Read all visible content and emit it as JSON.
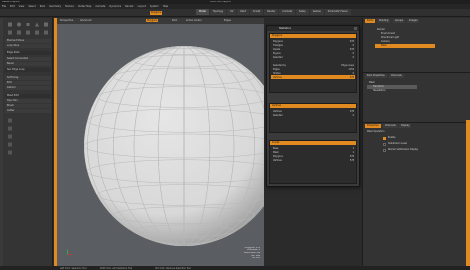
{
  "window": {
    "title": "Default Layout",
    "doc_title": "Modo 801 Layout"
  },
  "menu": [
    "File",
    "Edit",
    "View",
    "Select",
    "Item",
    "Geometry",
    "Texture",
    "Vertex Map",
    "Animate",
    "Dynamics",
    "Render",
    "Layout",
    "System",
    "Help"
  ],
  "topbar": {
    "mode_label": "Polygons",
    "tabs": [
      "Model",
      "Topology",
      "UV",
      "Paint",
      "Sculpt",
      "Render",
      "Animate",
      "Setup",
      "Games",
      "Schematic Fusion"
    ]
  },
  "left_panel": {
    "rows": [
      "Element Move",
      "Loop Slice",
      "Edge Slide",
      "Select Connected",
      "Bevel",
      "Sel. Edge Loop",
      "Soft Drag",
      "Edit",
      "Deform",
      "Mesh Edit",
      "Topo Pen",
      "Brush",
      "Cutter"
    ]
  },
  "viewport": {
    "header": [
      "Perspective",
      "Advanced",
      "Polygons",
      "Item",
      "Action Center",
      "Edges"
    ],
    "info": [
      "Polygons: 576",
      "Channels: 0",
      "Deformers: ON",
      "GL: 640",
      "20 mm"
    ]
  },
  "dialog": {
    "title": "Statistics",
    "sections": [
      {
        "title": "Polygons",
        "rows": [
          {
            "label": "Polygons",
            "value": "576"
          },
          {
            "label": "Triangles",
            "value": "0"
          },
          {
            "label": "Quads",
            "value": "576"
          },
          {
            "label": "N-gons",
            "value": "0"
          },
          {
            "label": "Selected",
            "value": "0"
          },
          {
            "label": "Selected by",
            "value": "Edge Loops"
          },
          {
            "label": "Edges",
            "value": "1152"
          },
          {
            "label": "Hidden",
            "value": "0"
          },
          {
            "label": "Vertices",
            "value": "578"
          }
        ]
      },
      {
        "title": "Vertices",
        "rows": [
          {
            "label": "Vertices",
            "value": "578"
          },
          {
            "label": "Selected",
            "value": "0"
          }
        ]
      },
      {
        "title": "Sculpt",
        "rows": [
          {
            "label": "Base",
            "value": "1"
          },
          {
            "label": "Mesh",
            "value": "1"
          },
          {
            "label": "Polygons",
            "value": "576"
          },
          {
            "label": "Vertices",
            "value": "578"
          }
        ]
      }
    ]
  },
  "right_panel": {
    "top_tabs": [
      "Items",
      "Shading",
      "Groups",
      "Images"
    ],
    "items": [
      "Render",
      "Environment",
      "Directional Light",
      "Camera",
      "Mesh"
    ],
    "selected_item": "Mesh",
    "mid_tabs": [
      "Item Properties",
      "Channels"
    ],
    "channels": [
      "Mesh",
      "Transform",
      "Tessellation"
    ],
    "props_tabs": [
      "Properties",
      "Channels",
      "Display"
    ],
    "props_title": "Mesh Operation",
    "props_rows": [
      {
        "label": "Enable",
        "on": true
      },
      {
        "label": "Subdivision Level",
        "on": false
      },
      {
        "label": "Render SubDivision Display",
        "on": false
      }
    ]
  },
  "statusbar": {
    "left": "Left Click: Selection Tool",
    "mid": "Shift Click: Add Selection Tool",
    "right": "Ctrl Click: Remove Selection Tool"
  },
  "colors": {
    "accent": "#e08a1f",
    "viewport_bg": "#5a5d61",
    "sphere": "#d8d8d8"
  }
}
